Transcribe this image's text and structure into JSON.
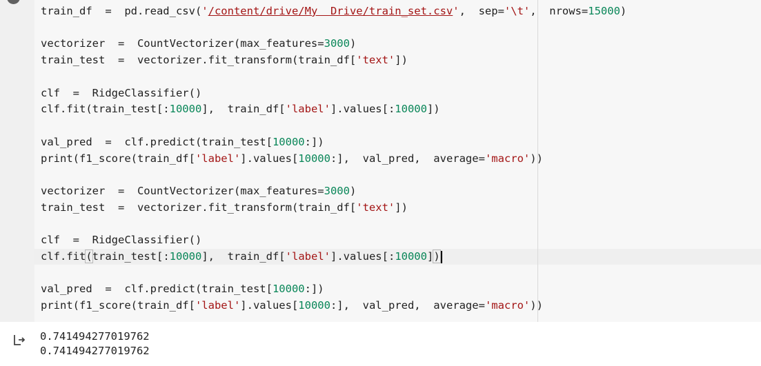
{
  "code_lines": [
    {
      "segments": [
        "train_df  =  pd.read_csv('",
        "/content/drive/My  Drive/train_set.csv",
        "',  sep='\\t',  nrows=15000)"
      ]
    },
    {
      "segments": [
        "vectorizer  =  CountVectorizer(max_features=3000)"
      ]
    },
    {
      "segments": [
        "train_test  =  vectorizer.fit_transform(train_df['text'])"
      ]
    },
    {
      "segments": [
        "clf  =  RidgeClassifier()"
      ]
    },
    {
      "segments": [
        "clf.fit(train_test[:10000],  train_df['label'].values[:10000])"
      ]
    },
    {
      "segments": [
        "val_pred  =  clf.predict(train_test[10000:])"
      ]
    },
    {
      "segments": [
        "print(f1_score(train_df['label'].values[10000:],  val_pred,  average='macro'))"
      ]
    },
    {
      "segments": [
        "vectorizer  =  CountVectorizer(max_features=3000)"
      ]
    },
    {
      "segments": [
        "train_test  =  vectorizer.fit_transform(train_df['text'])"
      ]
    },
    {
      "segments": [
        "clf  =  RidgeClassifier()"
      ]
    },
    {
      "segments": [
        "clf.fit",
        "(",
        "train_test[:10000],  train_df['label'].values[:10000]",
        ")"
      ]
    },
    {
      "segments": [
        "val_pred  =  clf.predict(train_test[10000:])"
      ]
    },
    {
      "segments": [
        "print(f1_score(train_df['label'].values[10000:],  val_pred,  average='macro'))"
      ]
    }
  ],
  "output": {
    "lines": [
      "0.741494277019762",
      "0.741494277019762"
    ]
  },
  "colors": {
    "string": "#a31515",
    "number": "#098658",
    "text": "#212121"
  },
  "icons": {
    "run": "run-cell-icon",
    "output": "output-arrow-icon"
  }
}
